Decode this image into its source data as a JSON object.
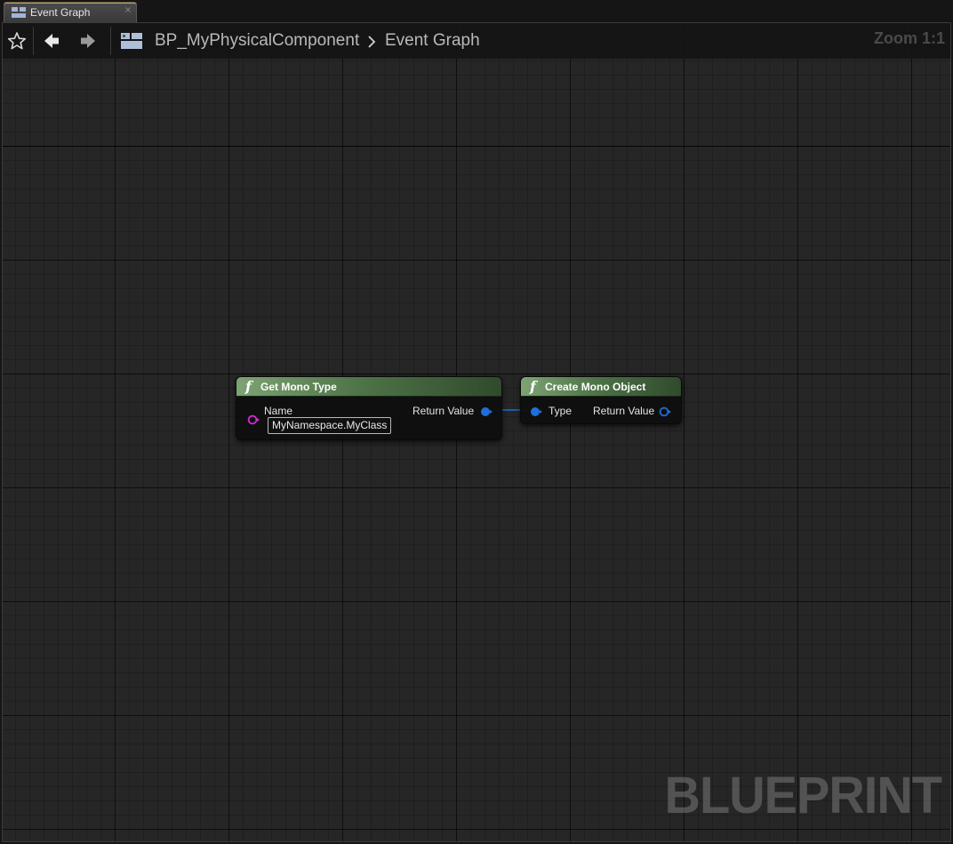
{
  "tab": {
    "label": "Event Graph",
    "close_glyph": "×",
    "icon": "blueprint-graph-icon"
  },
  "toolbar": {
    "favorite_icon": "star-icon",
    "back_icon": "arrow-left-icon",
    "forward_icon": "arrow-right-icon",
    "breadcrumb": {
      "asset": "BP_MyPhysicalComponent",
      "separator_icon": "chevron-right-icon",
      "graph": "Event Graph"
    },
    "zoom": "Zoom 1:1"
  },
  "nodes": {
    "get_mono_type": {
      "title": "Get Mono Type",
      "func_glyph": "f",
      "input_pin": {
        "label": "Name",
        "value": "MyNamespace.MyClass"
      },
      "output_pin": {
        "label": "Return Value"
      }
    },
    "create_mono_object": {
      "title": "Create Mono Object",
      "func_glyph": "f",
      "input_pin": {
        "label": "Type"
      },
      "output_pin": {
        "label": "Return Value"
      }
    }
  },
  "colors": {
    "function_header": "#5e8a55",
    "string_pin": "#d12bd1",
    "object_pin": "#1f6fd8",
    "wire": "#1f6fd8"
  },
  "watermark": "BLUEPRINT"
}
